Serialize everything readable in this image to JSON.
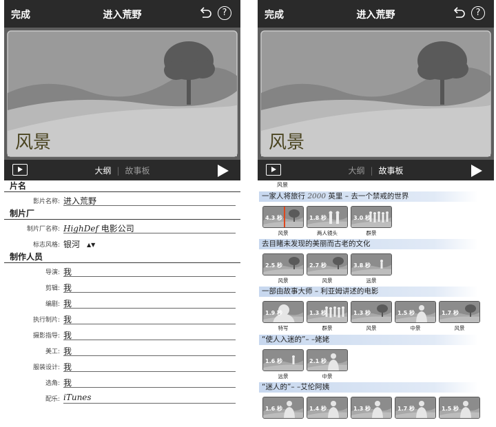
{
  "nav": {
    "done": "完成",
    "title": "进入荒野"
  },
  "preview": {
    "title": "风景"
  },
  "controls": {
    "tab_outline": "大纲",
    "tab_storyboard": "故事板"
  },
  "form": {
    "section_title": "片名",
    "movie_name_label": "影片名称:",
    "movie_name": "进入荒野",
    "section_studio": "制片厂",
    "studio_label": "制片厂名称:",
    "studio_script": "HighDef",
    "studio_suffix": " 电影公司",
    "logo_label": "标志风格:",
    "logo_value": "银河",
    "section_cast": "制作人员",
    "credits": [
      {
        "label": "导演:",
        "value": "我"
      },
      {
        "label": "剪辑:",
        "value": "我"
      },
      {
        "label": "编剧:",
        "value": "我"
      },
      {
        "label": "执行制片:",
        "value": "我"
      },
      {
        "label": "摄影指导:",
        "value": "我"
      },
      {
        "label": "美工:",
        "value": "我"
      },
      {
        "label": "服装设计:",
        "value": "我"
      },
      {
        "label": "选角:",
        "value": "我"
      },
      {
        "label": "配乐:",
        "value": "iTunes"
      }
    ]
  },
  "storyboard": {
    "top_label": "风景",
    "groups": [
      {
        "title_pre": "一家人将旅行 ",
        "title_hand": "2000",
        "title_post": " 英里 – 去一个禁戒的世界",
        "clips": [
          {
            "duration": "4.3 秒",
            "caption": "风景",
            "thumb": "tree"
          },
          {
            "duration": "1.8 秒",
            "caption": "两人镜头",
            "thumb": "two"
          },
          {
            "duration": "3.0 秒",
            "caption": "群景",
            "thumb": "group"
          }
        ]
      },
      {
        "title_pre": "去目睹未发现的美丽而古老的文化",
        "clips": [
          {
            "duration": "2.5 秒",
            "caption": "风景",
            "thumb": "tree"
          },
          {
            "duration": "2.7 秒",
            "caption": "风景",
            "thumb": "tree"
          },
          {
            "duration": "3.8 秒",
            "caption": "远景",
            "thumb": "far"
          }
        ]
      },
      {
        "title_pre": "一部由故事大师 – 利亚姆讲述的电影",
        "clips": [
          {
            "duration": "1.9 秒",
            "caption": "特写",
            "thumb": "close"
          },
          {
            "duration": "1.3 秒",
            "caption": "群景",
            "thumb": "group"
          },
          {
            "duration": "1.3 秒",
            "caption": "风景",
            "thumb": "tree"
          },
          {
            "duration": "1.5 秒",
            "caption": "中景",
            "thumb": "mid"
          },
          {
            "duration": "1.7 秒",
            "caption": "风景",
            "thumb": "tree"
          }
        ]
      },
      {
        "title_pre": "“使人入迷的”– –姥姥",
        "clips": [
          {
            "duration": "1.6 秒",
            "caption": "远景",
            "thumb": "far"
          },
          {
            "duration": "2.1 秒",
            "caption": "中景",
            "thumb": "mid"
          }
        ]
      },
      {
        "title_pre": "“迷人的”– –艾伦阿姨",
        "clips": [
          {
            "duration": "1.6 秒",
            "caption": "",
            "thumb": "mid"
          },
          {
            "duration": "1.4 秒",
            "caption": "",
            "thumb": "mid"
          },
          {
            "duration": "1.3 秒",
            "caption": "",
            "thumb": "mid"
          },
          {
            "duration": "1.7 秒",
            "caption": "",
            "thumb": "mid"
          },
          {
            "duration": "1.5 秒",
            "caption": "",
            "thumb": "mid"
          }
        ]
      }
    ]
  },
  "colors": {
    "bar": "#2a2a2a",
    "banner": "#aac3e6",
    "playhead": "#e0461c",
    "title_text": "#4a4420"
  }
}
